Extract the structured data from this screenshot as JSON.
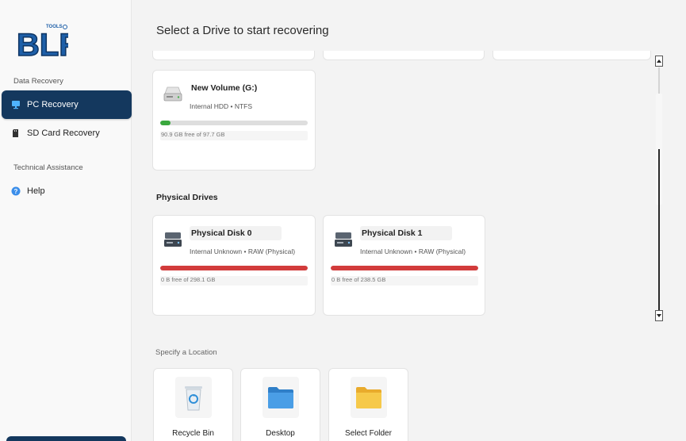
{
  "sidebar": {
    "logo_text": "BLR",
    "logo_small": "TOOLS",
    "section_data_recovery": "Data Recovery",
    "items": [
      {
        "label": "PC Recovery",
        "icon": "monitor-icon",
        "active": true
      },
      {
        "label": "SD Card Recovery",
        "icon": "sd-card-icon",
        "active": false
      }
    ],
    "section_technical": "Technical Assistance",
    "help": {
      "label": "Help",
      "icon": "question-circle-icon"
    }
  },
  "main": {
    "title": "Select a Drive to start recovering",
    "volume": {
      "name": "New Volume (G:)",
      "meta": "Internal HDD • NTFS",
      "free": "90.9 GB free of 97.7 GB",
      "used_fraction": 0.07,
      "bar_color": "#3aa83e"
    },
    "physical_heading": "Physical Drives",
    "physical": [
      {
        "name": "Physical Disk 0",
        "meta": "Internal Unknown • RAW (Physical)",
        "free": "0 B free of 298.1 GB",
        "used_fraction": 1.0,
        "bar_color": "#d23b3b"
      },
      {
        "name": "Physical Disk 1",
        "meta": "Internal Unknown • RAW (Physical)",
        "free": "0 B free of 238.5 GB",
        "used_fraction": 1.0,
        "bar_color": "#d23b3b"
      }
    ],
    "specify_label": "Specify a Location",
    "locations": [
      {
        "label": "Recycle Bin",
        "icon": "recycle-bin-icon"
      },
      {
        "label": "Desktop",
        "icon": "desktop-folder-icon"
      },
      {
        "label": "Select Folder",
        "icon": "folder-icon"
      }
    ]
  },
  "colors": {
    "accent": "#14385e",
    "ok": "#3aa83e",
    "full": "#d23b3b",
    "folder_blue": "#3d8fd6",
    "folder_yellow": "#f6c342"
  }
}
